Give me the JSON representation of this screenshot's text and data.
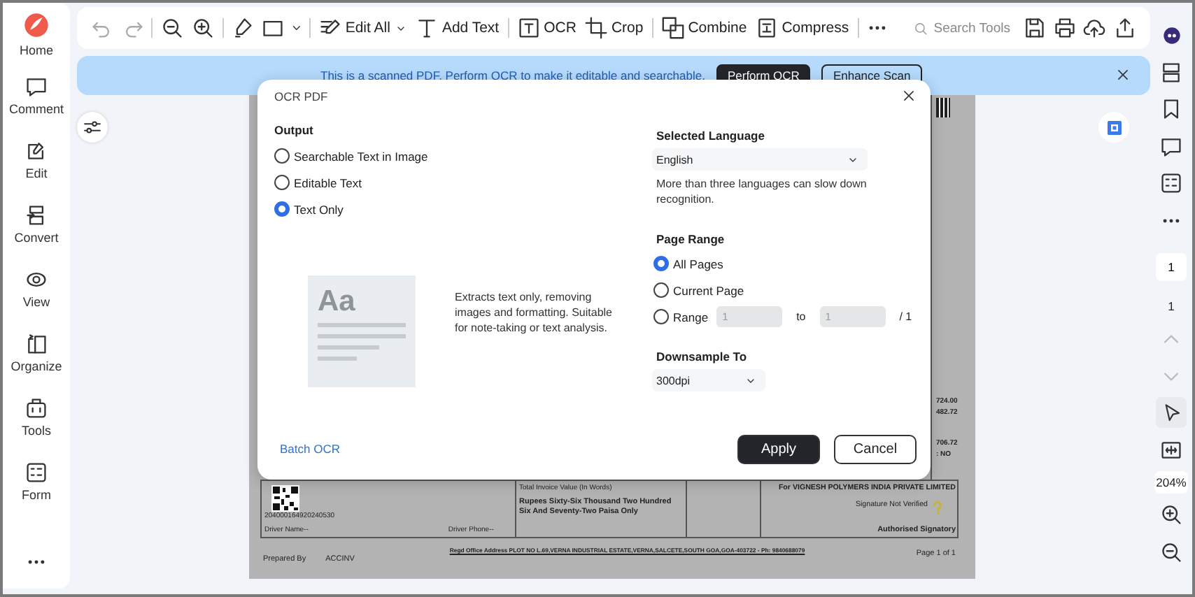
{
  "sidebar": {
    "items": [
      {
        "label": "Home"
      },
      {
        "label": "Comment"
      },
      {
        "label": "Edit"
      },
      {
        "label": "Convert"
      },
      {
        "label": "View"
      },
      {
        "label": "Organize"
      },
      {
        "label": "Tools"
      },
      {
        "label": "Form"
      }
    ]
  },
  "toolbar": {
    "tools": [
      {
        "label": "Edit All",
        "dropdown": true
      },
      {
        "label": "Add Text",
        "dropdown": false
      },
      {
        "label": "OCR",
        "dropdown": false
      },
      {
        "label": "Crop",
        "dropdown": false
      },
      {
        "label": "Combine",
        "dropdown": false
      },
      {
        "label": "Compress",
        "dropdown": false
      }
    ],
    "search": {
      "placeholder": "Search Tools"
    }
  },
  "banner": {
    "message": "This is a scanned PDF. Perform OCR to make it editable and searchable.",
    "buttons": [
      {
        "label": "Perform OCR",
        "primary": true
      },
      {
        "label": "Enhance Scan",
        "primary": false
      }
    ]
  },
  "document": {
    "right_edge_values": [
      "724.00",
      "482.72",
      "706.72",
      ": NO"
    ],
    "qr_number": "204000164920240530",
    "driver_name": "Driver Name--",
    "driver_phone": "Driver Phone--",
    "invoice_value_label": "Total Invoice Value (In Words)",
    "invoice_value_words": "Rupees  Sixty-Six Thousand Two Hundred Six And Seventy-Two Paisa Only",
    "company": "For VIGNESH POLYMERS INDIA PRIVATE LIMITED",
    "signature_status": "Signature Not Verified",
    "signatory": "Authorised Signatory",
    "office_address": "Regd Office Address PLOT NO L.69,VERNA INDUSTRIAL ESTATE,VERNA,SALCETE,SOUTH GOA,GOA-403722 - Ph: 9840688079",
    "prepared_by_label": "Prepared By",
    "prepared_by": "ACCINV",
    "page_label": "Page 1 of 1"
  },
  "dialog": {
    "title": "OCR PDF",
    "output": {
      "heading": "Output",
      "options": [
        {
          "label": "Searchable Text in Image",
          "selected": false
        },
        {
          "label": "Editable Text",
          "selected": false
        },
        {
          "label": "Text Only",
          "selected": true
        }
      ],
      "preview_glyph": "Aa",
      "description": "Extracts text only, removing images and formatting. Suitable for note-taking or text analysis."
    },
    "language": {
      "heading": "Selected Language",
      "value": "English",
      "hint": "More than three languages can slow down recognition."
    },
    "page_range": {
      "heading": "Page Range",
      "options": [
        {
          "label": "All Pages",
          "selected": true
        },
        {
          "label": "Current Page",
          "selected": false
        },
        {
          "label": "Range",
          "selected": false
        }
      ],
      "from": "1",
      "to_label": "to",
      "to": "1",
      "total": "/ 1",
      "disabled": true
    },
    "downsample": {
      "heading": "Downsample To",
      "value": "300dpi"
    },
    "batch_link": "Batch OCR",
    "buttons": [
      {
        "label": "Apply",
        "primary": true
      },
      {
        "label": "Cancel",
        "primary": false
      }
    ]
  },
  "right_rail": {
    "page_input": "1",
    "page_count": "1",
    "zoom": "204%"
  }
}
